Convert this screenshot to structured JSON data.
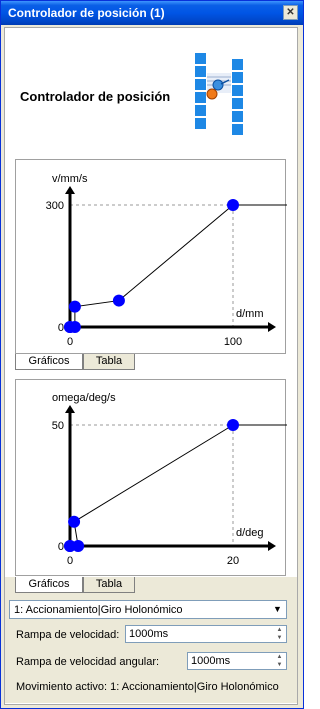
{
  "window": {
    "title": "Controlador de posición (1)",
    "close_label": "✕"
  },
  "header": {
    "title": "Controlador de posición",
    "logo_icon": "position-controller-icon"
  },
  "chart1": {
    "tabs": [
      "Gráficos",
      "Tabla"
    ],
    "active_tab": 0,
    "chart_data": {
      "type": "line",
      "xlabel": "d/mm",
      "ylabel": "v/mm/s",
      "x_ticks": [
        "0",
        "100"
      ],
      "y_ticks": [
        "0",
        "300"
      ],
      "xlim": [
        0,
        100
      ],
      "ylim": [
        0,
        300
      ],
      "points": [
        [
          0,
          0
        ],
        [
          0,
          0
        ],
        [
          3,
          0
        ],
        [
          3,
          50
        ],
        [
          30,
          65
        ],
        [
          100,
          300
        ]
      ],
      "line_color": "#000000",
      "point_color": "#0000ff"
    }
  },
  "chart2": {
    "tabs": [
      "Gráficos",
      "Tabla"
    ],
    "active_tab": 0,
    "chart_data": {
      "type": "line",
      "xlabel": "d/deg",
      "ylabel": "omega/deg/s",
      "x_ticks": [
        "0",
        "20"
      ],
      "y_ticks": [
        "0",
        "50"
      ],
      "xlim": [
        0,
        20
      ],
      "ylim": [
        0,
        50
      ],
      "points": [
        [
          0,
          0
        ],
        [
          0,
          0
        ],
        [
          1,
          0
        ],
        [
          0.5,
          10
        ],
        [
          20,
          50
        ]
      ],
      "line_color": "#000000",
      "point_color": "#0000ff"
    }
  },
  "controls": {
    "movement_select": "1: Accionamiento|Giro Holonómico",
    "speed_ramp_label": "Rampa de velocidad:",
    "speed_ramp_value": "1000ms",
    "angular_ramp_label": "Rampa de velocidad angular:",
    "angular_ramp_value": "1000ms",
    "status": "Movimiento activo: 1: Accionamiento|Giro Holonómico"
  }
}
